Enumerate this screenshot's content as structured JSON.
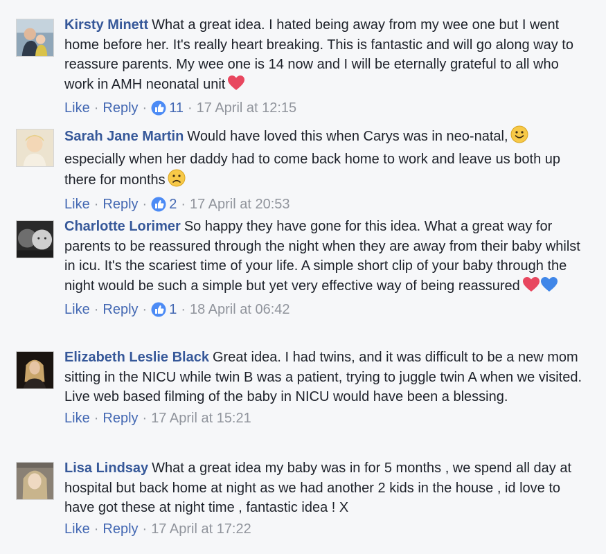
{
  "comments": [
    {
      "author": "Kirsty Minett",
      "text": "What a great idea. I hated being away from my wee one but I went home before her. It's really heart breaking. This is fantastic and will go along way to reassure parents. My wee one is 14 now and I will be eternally grateful to all who work in AMH neonatal unit",
      "emoji": [
        "red-heart"
      ],
      "like_label": "Like",
      "reply_label": "Reply",
      "reaction_count": "11",
      "timestamp": "17 April at 12:15"
    },
    {
      "author": "Sarah Jane Martin",
      "text_part1": "Would have loved this when Carys was in neo-natal,",
      "text_part2": "especially when her daddy had to come back home to work and leave us both up there for months",
      "emoji": [
        "smiley-face",
        "sad-face"
      ],
      "like_label": "Like",
      "reply_label": "Reply",
      "reaction_count": "2",
      "timestamp": "17 April at 20:53"
    },
    {
      "author": "Charlotte Lorimer",
      "text": "So happy they have gone for this idea. What a great way for parents to be reassured through the night when they are away from their baby whilst in icu. It's the scariest time of your life. A simple short clip of your baby through the night would be such a simple but yet very effective way of being reassured",
      "emoji": [
        "red-heart",
        "blue-heart"
      ],
      "like_label": "Like",
      "reply_label": "Reply",
      "reaction_count": "1",
      "timestamp": "18 April at 06:42"
    },
    {
      "author": "Elizabeth Leslie Black",
      "text": "Great idea. I had twins, and it was difficult to be a new mom sitting in the NICU while twin B was a patient, trying to juggle twin A when we visited. Live web based filming of the baby in NICU would have been a blessing.",
      "like_label": "Like",
      "reply_label": "Reply",
      "timestamp": "17 April at 15:21"
    },
    {
      "author": "Lisa Lindsay",
      "text": "What a great idea my baby was in for 5 months , we spend all day at hospital but back home at night as we had another 2 kids in the house , id love to have got these at night time , fantastic idea ! X",
      "like_label": "Like",
      "reply_label": "Reply",
      "timestamp": "17 April at 17:22"
    }
  ],
  "colors": {
    "background": "#f6f7f9",
    "author_link": "#365899",
    "action_link": "#4267b2",
    "meta_gray": "#90949c",
    "body_text": "#1d2129"
  }
}
